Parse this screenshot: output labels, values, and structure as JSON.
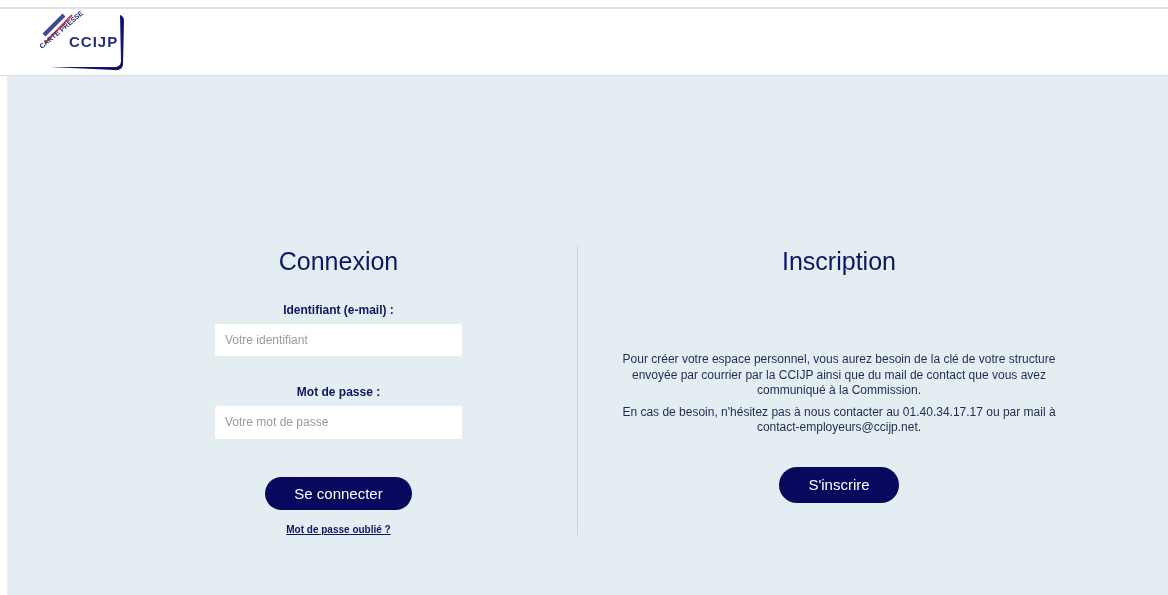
{
  "header": {
    "logo": {
      "name": "CCIJP",
      "tagline": "CARTE PRESSE"
    }
  },
  "login": {
    "title": "Connexion",
    "fields": [
      {
        "label": "Identifiant (e-mail) :",
        "placeholder": "Votre identifiant"
      },
      {
        "label": "Mot de passe :",
        "placeholder": "Votre mot de passe"
      }
    ],
    "button": "Se connecter",
    "forgot_link": "Mot de passe oublié ?"
  },
  "signup": {
    "title": "Inscription",
    "paragraphs": [
      "Pour créer votre espace personnel, vous aurez besoin de la clé de votre structure envoyée par courrier par la CCIJP ainsi que du mail de contact que vous avez communiqué à la Commission.",
      "En cas de besoin, n'hésitez pas à nous contacter au 01.40.34.17.17 ou par mail à contact-employeurs@ccijp.net."
    ],
    "button": "S'inscrire"
  }
}
